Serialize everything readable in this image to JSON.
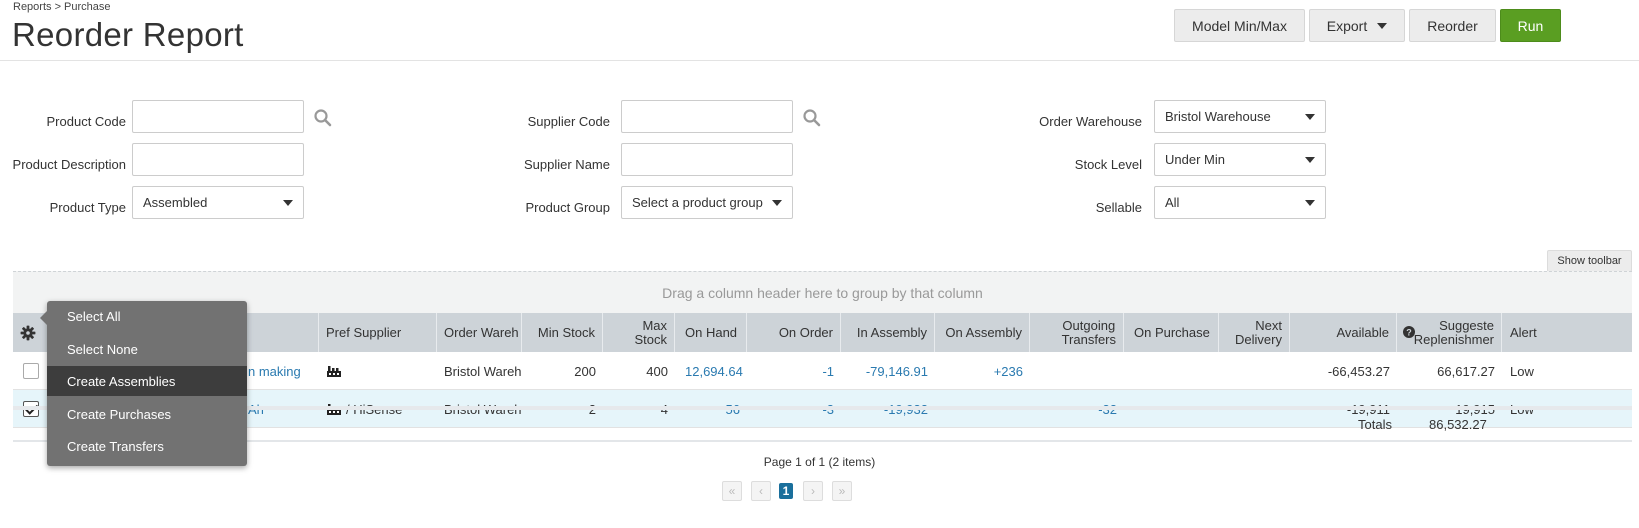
{
  "breadcrumb": "Reports > Purchase",
  "title": "Reorder Report",
  "buttons": {
    "model_min_max": "Model Min/Max",
    "export": "Export",
    "reorder": "Reorder",
    "run": "Run"
  },
  "filters": {
    "product_code": {
      "label": "Product Code",
      "value": ""
    },
    "product_description": {
      "label": "Product Description",
      "value": ""
    },
    "product_type": {
      "label": "Product Type",
      "value": "Assembled"
    },
    "supplier_code": {
      "label": "Supplier Code",
      "value": ""
    },
    "supplier_name": {
      "label": "Supplier Name",
      "value": ""
    },
    "product_group": {
      "label": "Product Group",
      "value": "Select a product group"
    },
    "order_warehouse": {
      "label": "Order Warehouse",
      "value": "Bristol Warehouse"
    },
    "stock_level": {
      "label": "Stock Level",
      "value": "Under Min"
    },
    "sellable": {
      "label": "Sellable",
      "value": "All"
    }
  },
  "toolbar": {
    "show_toolbar": "Show toolbar"
  },
  "group_hint": "Drag a column header here to group by that column",
  "columns": {
    "pref_supplier": "Pref Supplier",
    "order_warehouse": "Order Wareh",
    "min_stock": "Min Stock",
    "max_stock_1": "Max",
    "max_stock_2": "Stock",
    "on_hand": "On Hand",
    "on_order": "On Order",
    "in_assembly": "In Assembly",
    "on_assembly": "On Assembly",
    "outgoing_1": "Outgoing",
    "outgoing_2": "Transfers",
    "on_purchase": "On Purchase",
    "next_1": "Next",
    "next_2": "Delivery",
    "available": "Available",
    "suggested_1": "Suggeste",
    "suggested_2": "Replenishmer",
    "alert": "Alert"
  },
  "rows": [
    {
      "selected": false,
      "product": "n making",
      "pref_supplier": "",
      "order_warehouse": "Bristol Wareho",
      "min_stock": "200",
      "max_stock": "400",
      "on_hand": "12,694.64",
      "on_order": "-1",
      "in_assembly": "-79,146.91",
      "on_assembly": "+236",
      "outgoing_transfers": "",
      "on_purchase": "",
      "next_delivery": "",
      "available": "-66,453.27",
      "suggested": "66,617.27",
      "alert": "Low"
    },
    {
      "selected": true,
      "product": "Ah",
      "pref_supplier": "/ HiSense",
      "order_warehouse": "Bristol Wareho",
      "min_stock": "2",
      "max_stock": "4",
      "on_hand": "56",
      "on_order": "-3",
      "in_assembly": "-19,932",
      "on_assembly": "",
      "outgoing_transfers": "-32",
      "on_purchase": "",
      "next_delivery": "",
      "available": "-19,911",
      "suggested": "19,915",
      "alert": "Low"
    }
  ],
  "totals": {
    "label": "Totals",
    "suggested": "86,532.27"
  },
  "pager": {
    "text": "Page 1 of 1 (2 items)",
    "first": "«",
    "prev": "‹",
    "current": "1",
    "next": "›",
    "last": "»"
  },
  "menu": {
    "items": [
      "Select All",
      "Select None",
      "Create Assemblies",
      "Create Purchases",
      "Create Transfers"
    ],
    "highlighted": "Create Assemblies"
  },
  "colors": {
    "accent": "#5a9e22",
    "link": "#2a7ab0",
    "header_bg": "#cdd3d8",
    "selected_row": "#e6f5fa"
  }
}
